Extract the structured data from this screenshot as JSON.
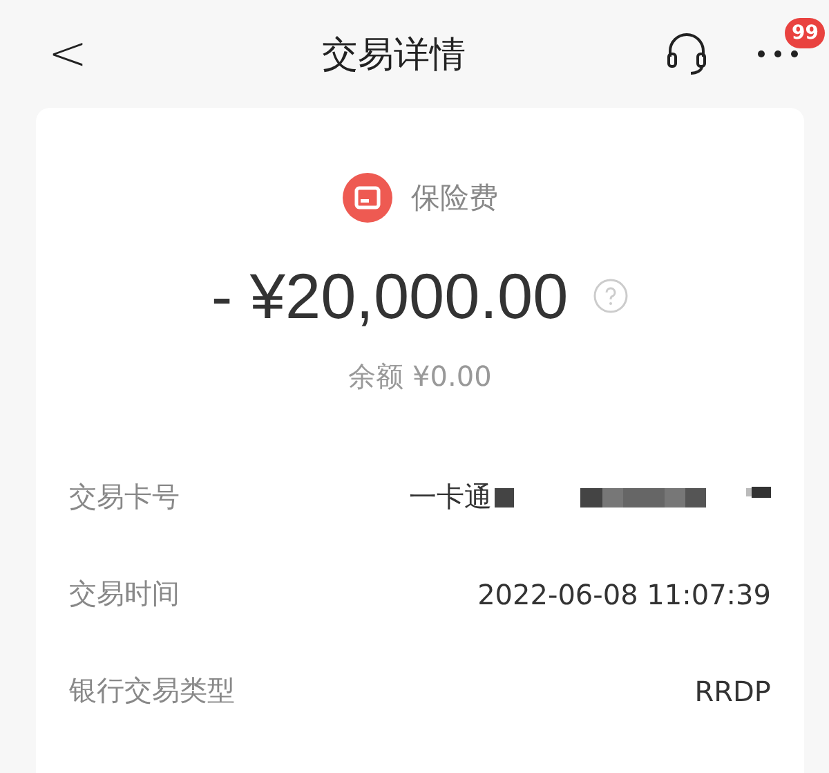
{
  "header": {
    "back": "<",
    "title": "交易详情",
    "badge": "99"
  },
  "transaction": {
    "category": "保险费",
    "amount": "- ¥20,000.00",
    "balance": "余额 ¥0.00"
  },
  "details": [
    {
      "label": "交易卡号",
      "value": "一卡通",
      "kind": "redacted"
    },
    {
      "label": "交易时间",
      "value": "2022-06-08 11:07:39",
      "kind": "text"
    },
    {
      "label": "银行交易类型",
      "value": "RRDP",
      "kind": "text"
    }
  ]
}
